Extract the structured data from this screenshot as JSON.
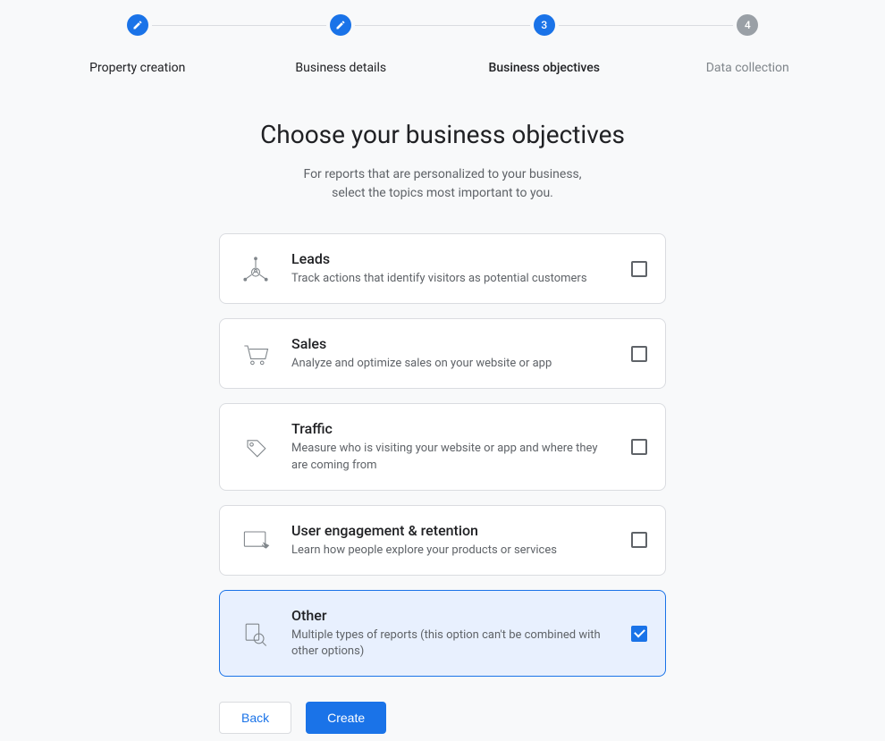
{
  "stepper": {
    "steps": [
      {
        "label": "Property creation",
        "state": "completed",
        "icon": "pencil"
      },
      {
        "label": "Business details",
        "state": "completed",
        "icon": "pencil"
      },
      {
        "label": "Business objectives",
        "state": "active",
        "number": "3"
      },
      {
        "label": "Data collection",
        "state": "upcoming",
        "number": "4"
      }
    ]
  },
  "heading": {
    "title": "Choose your business objectives",
    "subtitle_line1": "For reports that are personalized to your business,",
    "subtitle_line2": "select the topics most important to you."
  },
  "objectives": [
    {
      "id": "leads",
      "title": "Leads",
      "desc": "Track actions that identify visitors as potential customers",
      "checked": false,
      "icon": "leads"
    },
    {
      "id": "sales",
      "title": "Sales",
      "desc": "Analyze and optimize sales on your website or app",
      "checked": false,
      "icon": "cart"
    },
    {
      "id": "traffic",
      "title": "Traffic",
      "desc": "Measure who is visiting your website or app and where they are coming from",
      "checked": false,
      "icon": "tag"
    },
    {
      "id": "engagement",
      "title": "User engagement & retention",
      "desc": "Learn how people explore your products or services",
      "checked": false,
      "icon": "screen"
    },
    {
      "id": "other",
      "title": "Other",
      "desc": "Multiple types of reports (this option can't be combined with other options)",
      "checked": true,
      "icon": "magnify"
    }
  ],
  "buttons": {
    "back": "Back",
    "create": "Create"
  }
}
